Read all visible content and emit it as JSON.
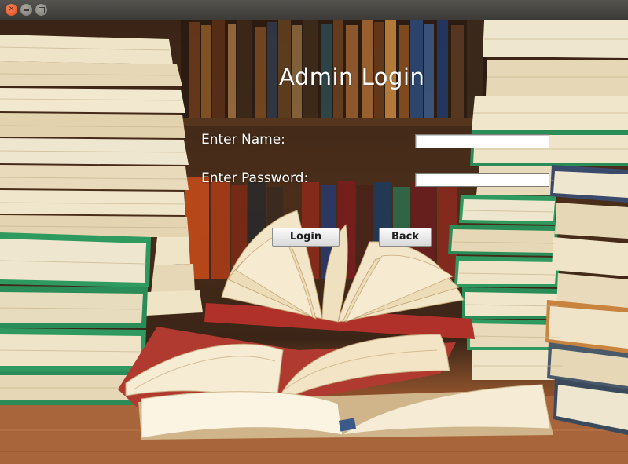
{
  "window": {
    "controls": [
      "close-icon",
      "minimize-icon",
      "maximize-icon"
    ]
  },
  "form": {
    "title": "Admin Login",
    "name_label": "Enter Name:",
    "name_value": "",
    "password_label": "Enter Password:",
    "password_value": "",
    "login_label": "Login",
    "back_label": "Back"
  },
  "colors": {
    "text": "#ffffff",
    "titlebar": "#3c3b37",
    "close_button": "#df4a16",
    "book_green": "#2f9a5f",
    "wood_table": "#a8643a"
  }
}
